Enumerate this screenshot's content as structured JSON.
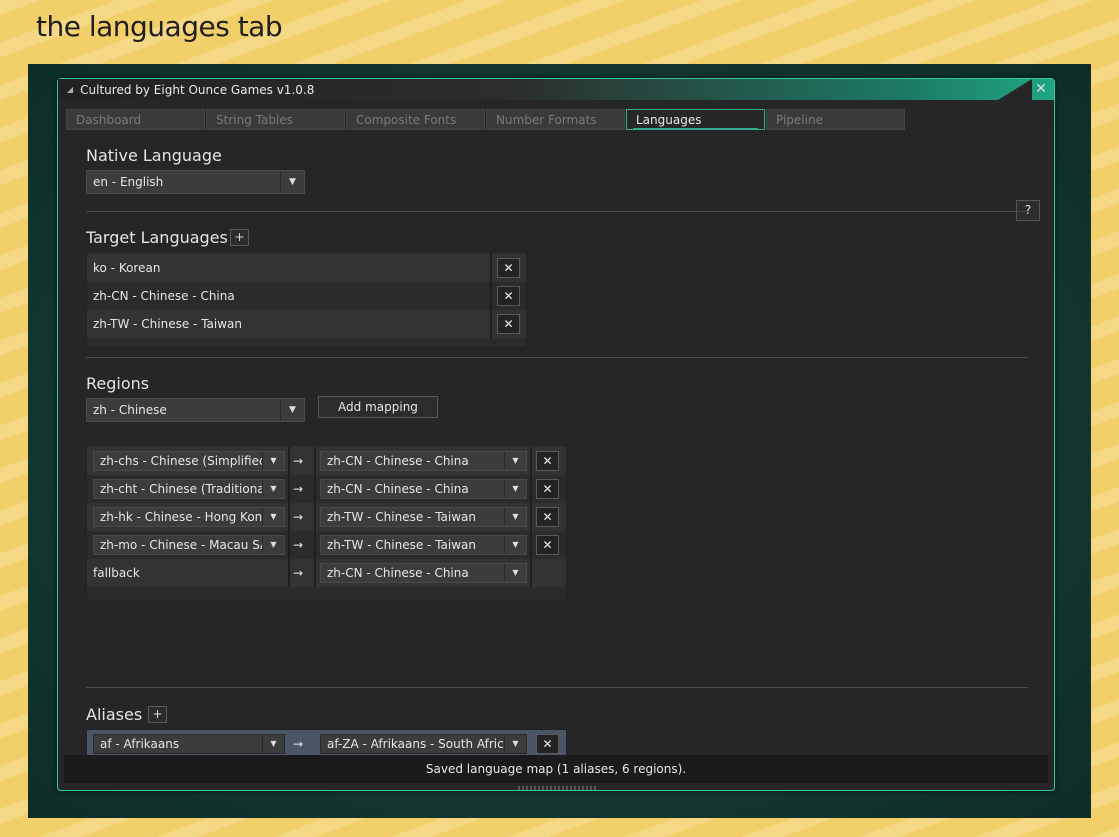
{
  "page_heading": "the languages tab",
  "window": {
    "title": "Cultured by Eight Ounce Games  v1.0.8",
    "close_glyph": "✕"
  },
  "tabs": [
    {
      "label": "Dashboard",
      "active": false
    },
    {
      "label": "String Tables",
      "active": false
    },
    {
      "label": "Composite Fonts",
      "active": false
    },
    {
      "label": "Number Formats",
      "active": false
    },
    {
      "label": "Languages",
      "active": true
    },
    {
      "label": "Pipeline",
      "active": false
    }
  ],
  "help_label": "?",
  "native": {
    "title": "Native Language",
    "selected": "en - English"
  },
  "targets": {
    "title": "Target Languages",
    "add_label": "+",
    "items": [
      "ko - Korean",
      "zh-CN - Chinese - China",
      "zh-TW - Chinese - Taiwan"
    ]
  },
  "regions": {
    "title": "Regions",
    "selected": "zh - Chinese",
    "add_mapping_label": "Add mapping",
    "mappings": [
      {
        "from": "zh-chs - Chinese (Simplified)",
        "to": "zh-CN - Chinese - China"
      },
      {
        "from": "zh-cht - Chinese (Traditional)",
        "to": "zh-CN - Chinese - China"
      },
      {
        "from": "zh-hk - Chinese - Hong Kong SAR",
        "to": "zh-TW - Chinese - Taiwan"
      },
      {
        "from": "zh-mo - Chinese - Macau SAR",
        "to": "zh-TW - Chinese - Taiwan"
      }
    ],
    "fallback": {
      "label": "fallback",
      "to": "zh-CN - Chinese - China"
    }
  },
  "aliases": {
    "title": "Aliases",
    "add_label": "+",
    "items": [
      {
        "from": "af - Afrikaans",
        "to": "af-ZA - Afrikaans - South Africa"
      }
    ]
  },
  "arrow_glyph": "→",
  "remove_glyph": "✕",
  "status": "Saved language map (1 aliases, 6 regions).",
  "colors": {
    "accent": "#2fae8d",
    "window_bg": "#262626",
    "highlight_row": "#4a5566"
  }
}
